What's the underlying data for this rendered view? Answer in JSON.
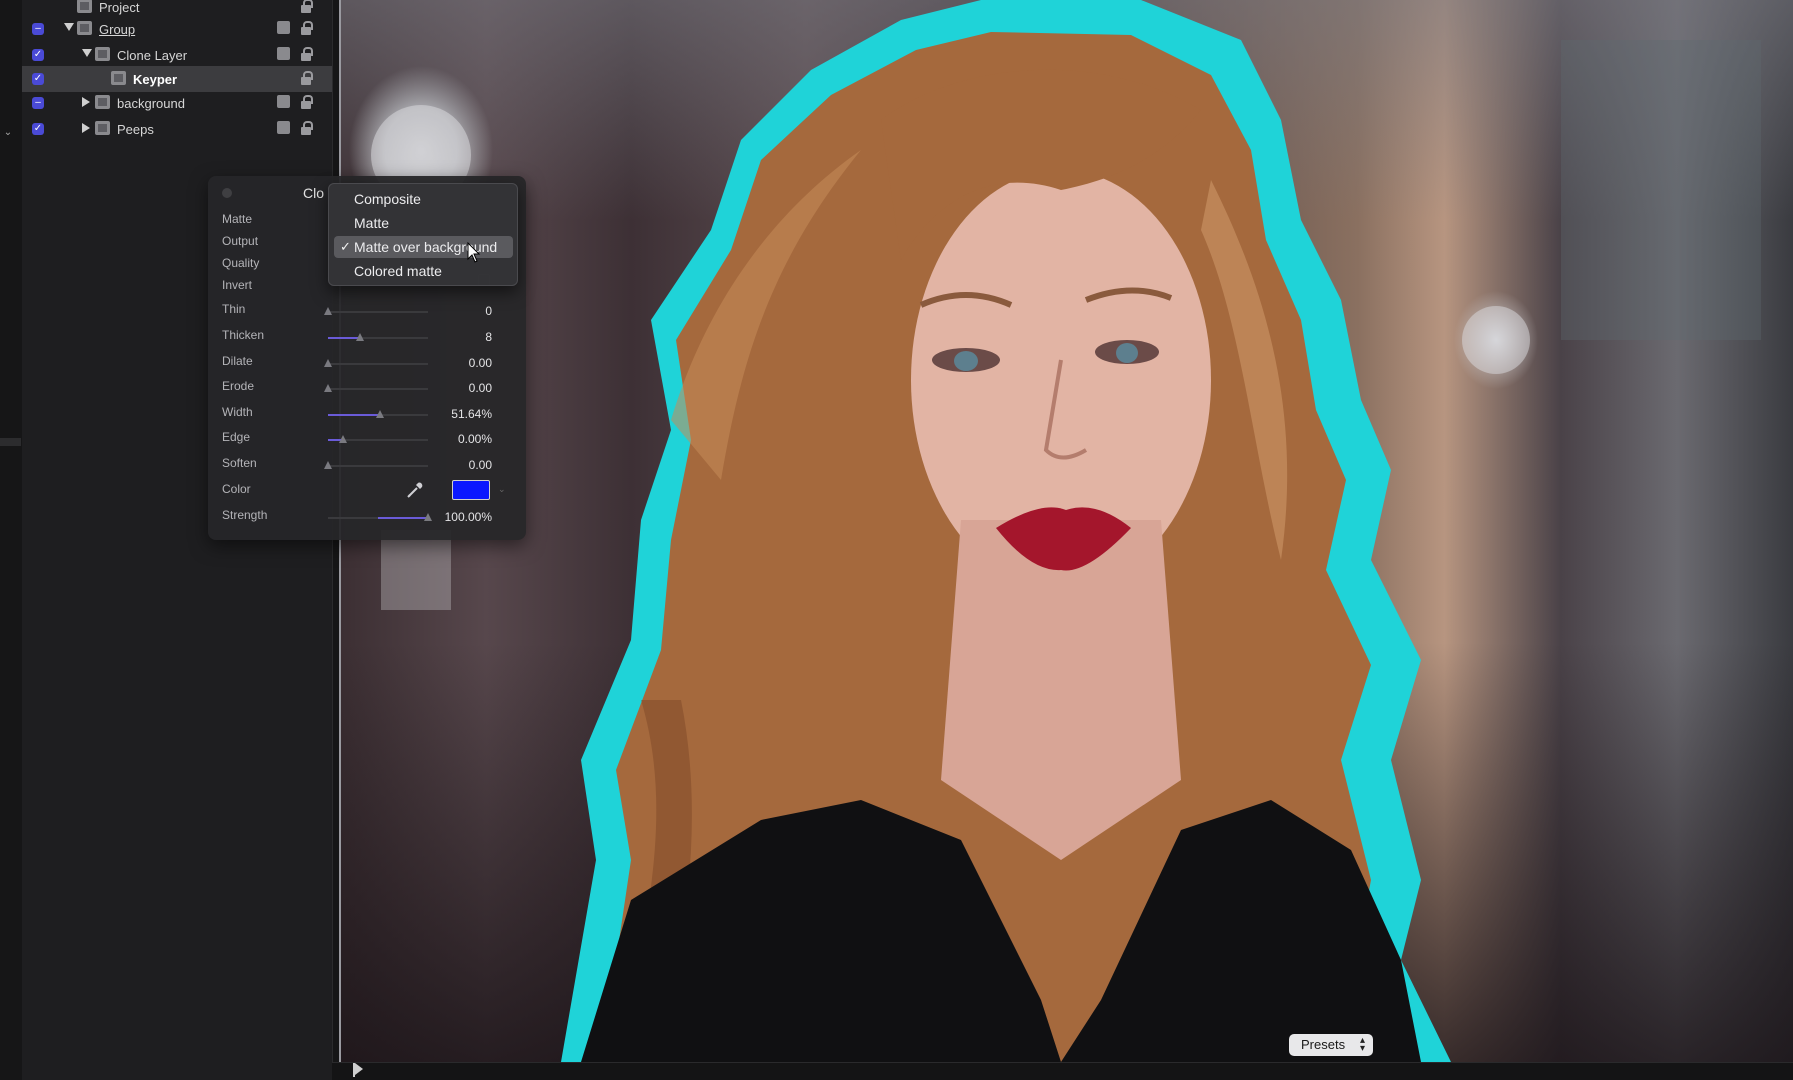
{
  "layers": [
    {
      "name": "Project",
      "level": 0,
      "checkbox": "",
      "disclosure": "none",
      "selected": false
    },
    {
      "name": "Group",
      "level": 0,
      "checkbox": "minus",
      "disclosure": "down",
      "selected": false
    },
    {
      "name": "Clone Layer",
      "level": 1,
      "checkbox": "check",
      "disclosure": "down",
      "selected": false
    },
    {
      "name": "Keyper",
      "level": 2,
      "checkbox": "check",
      "disclosure": "none",
      "selected": true
    },
    {
      "name": "background",
      "level": 1,
      "checkbox": "minus",
      "disclosure": "right",
      "selected": false
    },
    {
      "name": "Peeps",
      "level": 1,
      "checkbox": "check",
      "disclosure": "right",
      "selected": false
    }
  ],
  "hud": {
    "title": "Clo",
    "rows": [
      {
        "label": "Matte",
        "value": "",
        "slider": null
      },
      {
        "label": "Output",
        "value": "",
        "slider": null
      },
      {
        "label": "Quality",
        "value": "",
        "slider": null
      },
      {
        "label": "Invert",
        "value": "",
        "slider": null
      },
      {
        "label": "Thin",
        "value": "0",
        "slider": 0.0
      },
      {
        "label": "Thicken",
        "value": "8",
        "slider": 0.32
      },
      {
        "label": "Dilate",
        "value": "0.00",
        "slider": 0.0
      },
      {
        "label": "Erode",
        "value": "0.00",
        "slider": 0.0
      },
      {
        "label": "Width",
        "value": "51.64%",
        "slider": 0.52
      },
      {
        "label": "Edge",
        "value": "0.00%",
        "slider": 0.15
      },
      {
        "label": "Soften",
        "value": "0.00",
        "slider": 0.0
      },
      {
        "label": "Color",
        "value": "",
        "slider": null
      },
      {
        "label": "Strength",
        "value": "100.00%",
        "slider": 1.0,
        "slider_start": 0.5
      }
    ],
    "color_value": "#0a17ff"
  },
  "popup_menu": {
    "items": [
      {
        "label": "Composite",
        "checked": false,
        "highlighted": false
      },
      {
        "label": "Matte",
        "checked": false,
        "highlighted": false
      },
      {
        "label": "Matte over background",
        "checked": true,
        "highlighted": true
      },
      {
        "label": "Colored matte",
        "checked": false,
        "highlighted": false
      }
    ],
    "check_glyph": "✓"
  },
  "viewer": {
    "presets_label": "Presets",
    "outline_color": "#1fd3d8"
  },
  "icons": {
    "eyedropper": "eyedropper-icon",
    "lock": "lock-icon",
    "cursor": "cursor-icon",
    "layer": "layer-icon"
  }
}
